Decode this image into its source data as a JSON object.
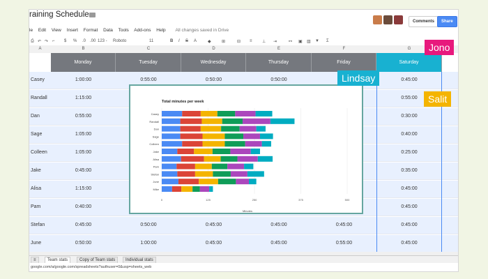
{
  "doc": {
    "title": "raining Schedule",
    "saved_text": "All changes saved in Drive"
  },
  "menu": [
    "le",
    "Edit",
    "View",
    "Insert",
    "Format",
    "Data",
    "Tools",
    "Add-ons",
    "Help"
  ],
  "buttons": {
    "comments": "Comments",
    "share": "Share"
  },
  "toolbar": {
    "dollar": "$",
    "percent": "%",
    "dec0": ".0",
    "dec00": ".00",
    "format123": "123 -",
    "font": "Roboto",
    "size": "11"
  },
  "columns": [
    "A",
    "B",
    "C",
    "D",
    "E",
    "F",
    "G"
  ],
  "days": [
    "Monday",
    "Tuesday",
    "Wednesday",
    "Thursday",
    "Friday",
    "Saturday"
  ],
  "rows": [
    {
      "name": "Casey",
      "v": [
        "1:00:00",
        "0:55:00",
        "0:50:00",
        "0:50:00",
        "",
        "0:45:00"
      ]
    },
    {
      "name": "Randall",
      "v": [
        "1:15:00",
        "",
        "",
        "",
        "",
        "0:55:00"
      ]
    },
    {
      "name": "Dan",
      "v": [
        "0:55:00",
        "",
        "",
        "",
        "",
        "0:30:00"
      ]
    },
    {
      "name": "Sage",
      "v": [
        "1:05:00",
        "",
        "",
        "",
        "",
        "0:40:00"
      ]
    },
    {
      "name": "Colleen",
      "v": [
        "1:05:00",
        "",
        "",
        "",
        "",
        "0:25:00"
      ]
    },
    {
      "name": "Jake",
      "v": [
        "0:45:00",
        "",
        "",
        "",
        "",
        "0:35:00"
      ]
    },
    {
      "name": "Alisa",
      "v": [
        "1:15:00",
        "",
        "",
        "",
        "",
        "0:45:00"
      ]
    },
    {
      "name": "Pam",
      "v": [
        "0:40:00",
        "",
        "",
        "",
        "",
        "0:45:00"
      ]
    },
    {
      "name": "Stefan",
      "v": [
        "0:45:00",
        "0:50:00",
        "0:45:00",
        "0:45:00",
        "0:45:00",
        "0:45:00"
      ]
    },
    {
      "name": "June",
      "v": [
        "0:50:00",
        "1:00:00",
        "0:45:00",
        "0:45:00",
        "0:55:00",
        "0:45:00"
      ]
    }
  ],
  "tabs": [
    "Team stats",
    "Copy of Team stats",
    "Individual stats"
  ],
  "status_url": "google.com/a/google.com/spreadsheets?authuser=0&usp=sheets_web",
  "collaborators": [
    {
      "name": "Jono",
      "color": "#e8197d"
    },
    {
      "name": "Lindsay",
      "color": "#18b1d1"
    },
    {
      "name": "Salit",
      "color": "#f4b400"
    }
  ],
  "chart_data": {
    "type": "bar",
    "stacked": true,
    "orientation": "horizontal",
    "title": "Total minutes per week",
    "xlabel": "Minutes",
    "ylabel": "",
    "xlim": [
      0,
      300
    ],
    "xticks": [
      0,
      125,
      250,
      375,
      500
    ],
    "categories": [
      "Casey",
      "Randall",
      "Dan",
      "Sage",
      "Colleen",
      "Jake",
      "Alisa",
      "Pam",
      "Stefan",
      "June",
      "Mike"
    ],
    "series": [
      {
        "color": "#4a8af4",
        "values": [
          55,
          50,
          50,
          50,
          55,
          42,
          52,
          40,
          42,
          45,
          28
        ]
      },
      {
        "color": "#db4437",
        "values": [
          50,
          58,
          55,
          60,
          55,
          45,
          62,
          50,
          48,
          55,
          25
        ]
      },
      {
        "color": "#f4b400",
        "values": [
          45,
          55,
          55,
          60,
          60,
          50,
          45,
          45,
          48,
          52,
          30
        ]
      },
      {
        "color": "#0f9d58",
        "values": [
          48,
          55,
          50,
          50,
          55,
          48,
          45,
          42,
          48,
          48,
          20
        ]
      },
      {
        "color": "#ab47bc",
        "values": [
          55,
          75,
          45,
          45,
          45,
          55,
          55,
          45,
          45,
          35,
          25
        ]
      },
      {
        "color": "#00acc1",
        "values": [
          45,
          65,
          25,
          35,
          25,
          25,
          40,
          25,
          45,
          20,
          10
        ]
      }
    ]
  }
}
